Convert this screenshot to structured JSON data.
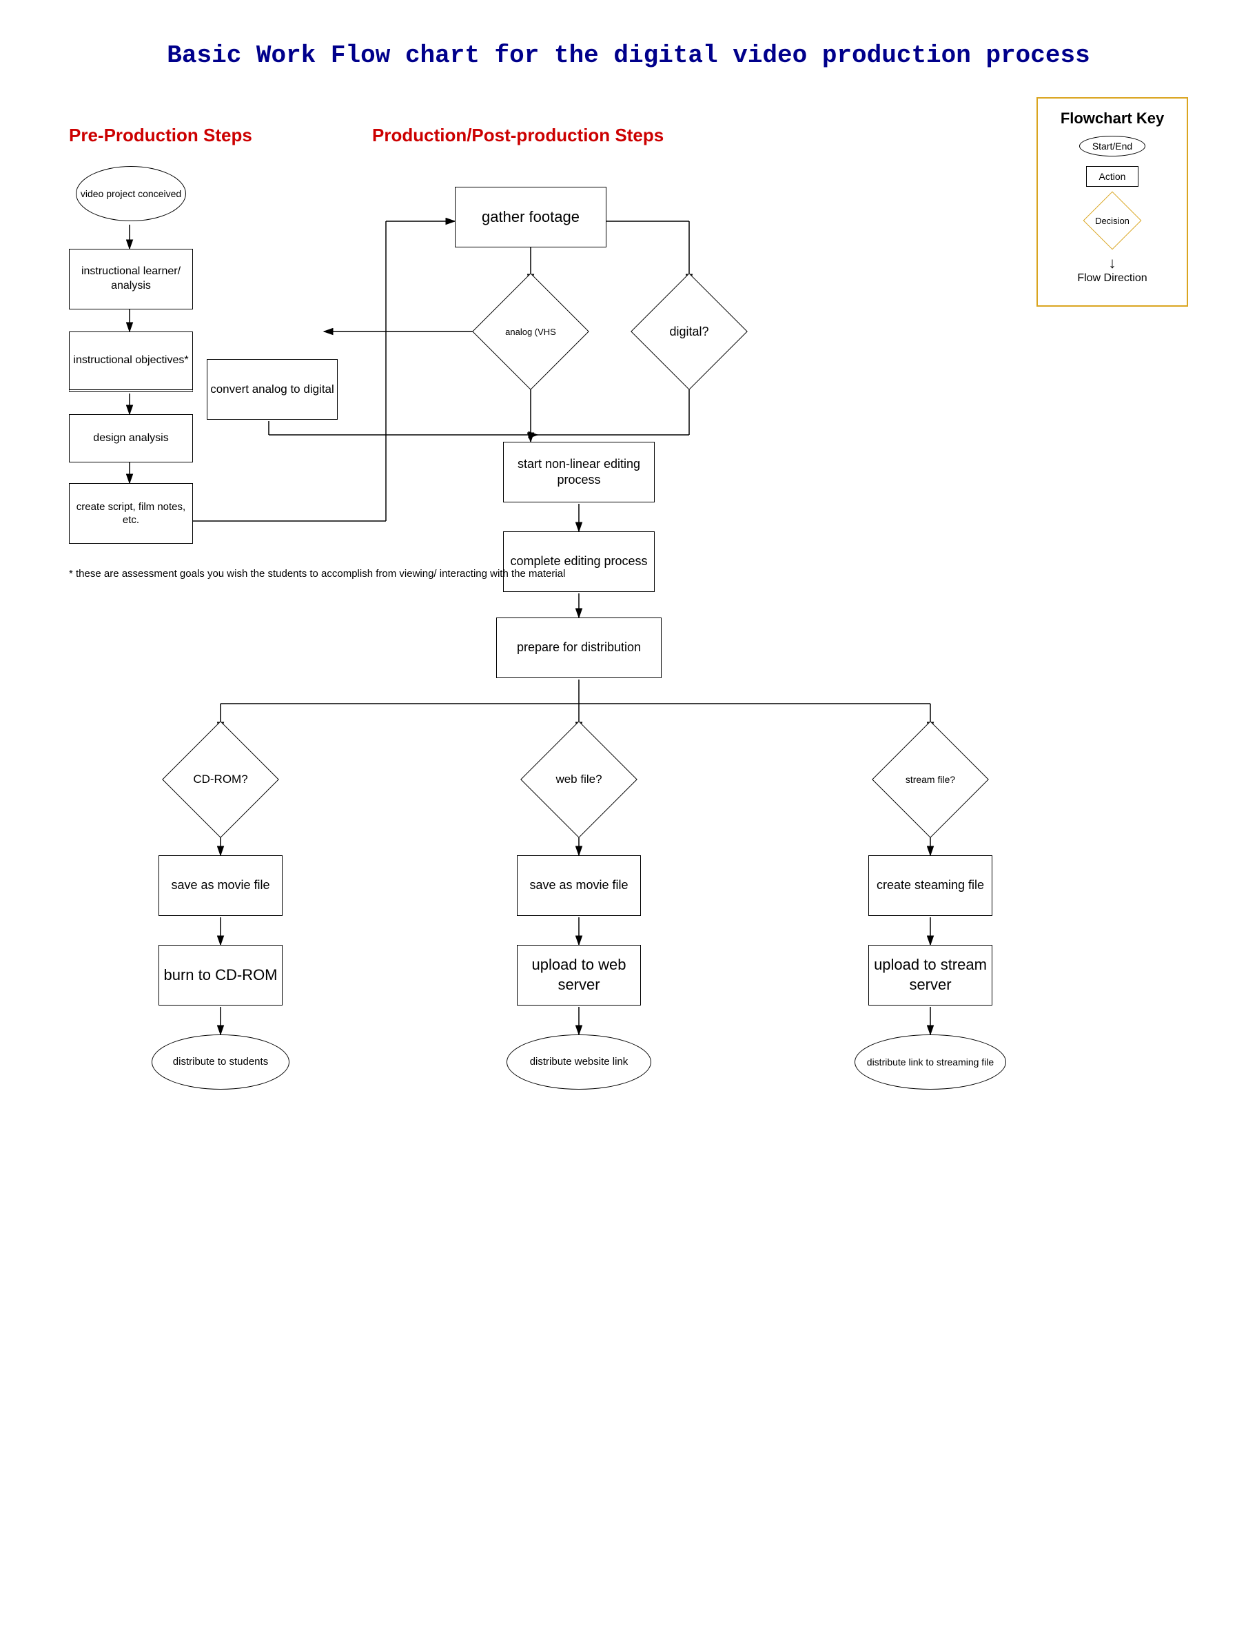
{
  "title": "Basic Work Flow chart for the digital video production process",
  "sections": {
    "pre_production": "Pre-Production Steps",
    "production": "Production/Post-production Steps"
  },
  "key": {
    "title": "Flowchart Key",
    "start_end": "Start/End",
    "action": "Action",
    "decision": "Decision",
    "flow": "Flow Direction"
  },
  "nodes": {
    "video_project": "video project\nconceived",
    "instructional_learner": "instructional\nlearner/ analysis",
    "instructional_objectives": "instructional\nobjectives*",
    "design_analysis": "design\nanalysis",
    "create_script": "create script,\nfilm notes, etc.",
    "gather_footage": "gather footage",
    "analog_vhs": "analog (VHS",
    "digital": "digital?",
    "convert_analog": "convert analog\nto digital",
    "start_nonlinear": "start non-linear\nediting process",
    "complete_editing": "complete\nediting process",
    "prepare_distribution": "prepare for\ndistribution",
    "cdrom_decision": "CD-ROM?",
    "web_file_decision": "web file?",
    "stream_file_decision": "stream\nfile?",
    "save_movie_cdrom": "save as movie\nfile",
    "save_movie_web": "save as movie\nfile",
    "create_streaming": "create\nsteaming file",
    "burn_cdrom": "burn to\nCD-ROM",
    "upload_web": "upload to\nweb server",
    "upload_stream": "upload to\nstream server",
    "distribute_students": "distribute to students",
    "distribute_website": "distribute website link",
    "distribute_streaming": "distribute link to\nstreaming file"
  },
  "footnote": "* these are assessment goals you wish the\nstudents to accomplish from viewing/ interacting\nwith the material"
}
